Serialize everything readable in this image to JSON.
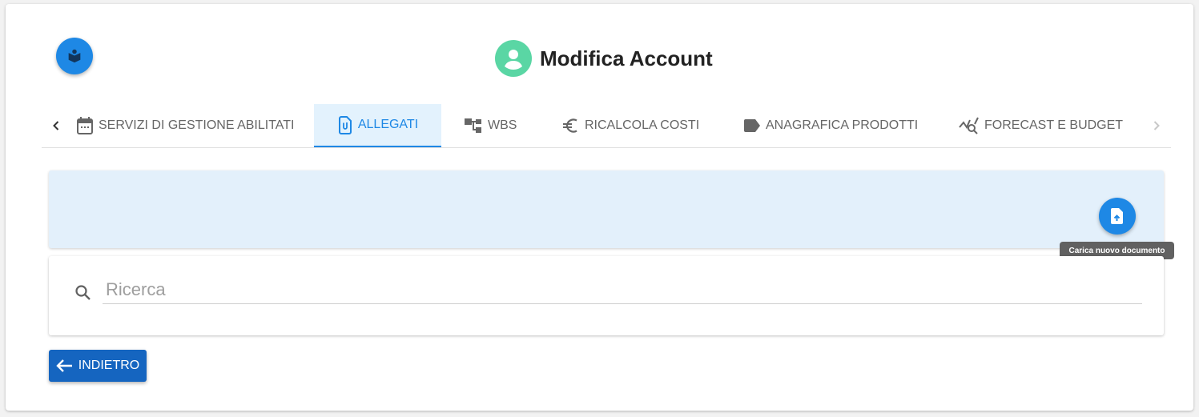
{
  "header": {
    "title": "Modifica Account"
  },
  "tabs": [
    {
      "label": "SERVIZI DI GESTIONE ABILITATI",
      "icon": "calendar-icon",
      "active": false
    },
    {
      "label": "ALLEGATI",
      "icon": "attachment-icon",
      "active": true
    },
    {
      "label": "WBS",
      "icon": "tree-structure-icon",
      "active": false
    },
    {
      "label": "RICALCOLA COSTI",
      "icon": "euro-icon",
      "active": false
    },
    {
      "label": "ANAGRAFICA PRODOTTI",
      "icon": "label-icon",
      "active": false
    },
    {
      "label": "FORECAST E BUDGET",
      "icon": "query-stats-icon",
      "active": false
    }
  ],
  "upload": {
    "tooltip": "Carica nuovo documento"
  },
  "search": {
    "placeholder": "Ricerca",
    "value": ""
  },
  "back_button": {
    "label": "INDIETRO"
  },
  "colors": {
    "primary": "#1e88e5",
    "back_button": "#1565c0",
    "banner": "#e3f0fb",
    "avatar": "#5ad6a4",
    "tooltip": "#616161"
  }
}
